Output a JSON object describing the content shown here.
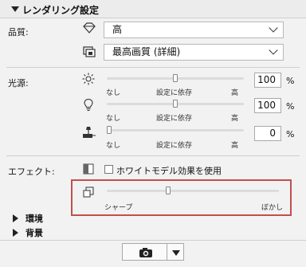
{
  "header": {
    "title": "レンダリング設定"
  },
  "quality": {
    "label": "品質:",
    "select1": "高",
    "select2": "最高画質 (詳細)"
  },
  "light": {
    "label": "光源:",
    "sliders": [
      {
        "min": "なし",
        "mid": "設定に依存",
        "max": "高",
        "value": "100",
        "unit": "%",
        "level": 0.5
      },
      {
        "min": "なし",
        "mid": "設定に依存",
        "max": "高",
        "value": "100",
        "unit": "%",
        "level": 0.5
      },
      {
        "min": "なし",
        "mid": "設定に依存",
        "max": "高",
        "value": "0",
        "unit": "%",
        "level": 0.0
      }
    ]
  },
  "effect": {
    "label": "エフェクト:",
    "checkbox_label": "ホワイトモデル効果を使用",
    "checked": false,
    "sharpness": {
      "min": "シャープ",
      "max": "ぼかし",
      "level": 0.35
    }
  },
  "collapsed_sections": [
    "環境",
    "背景"
  ]
}
